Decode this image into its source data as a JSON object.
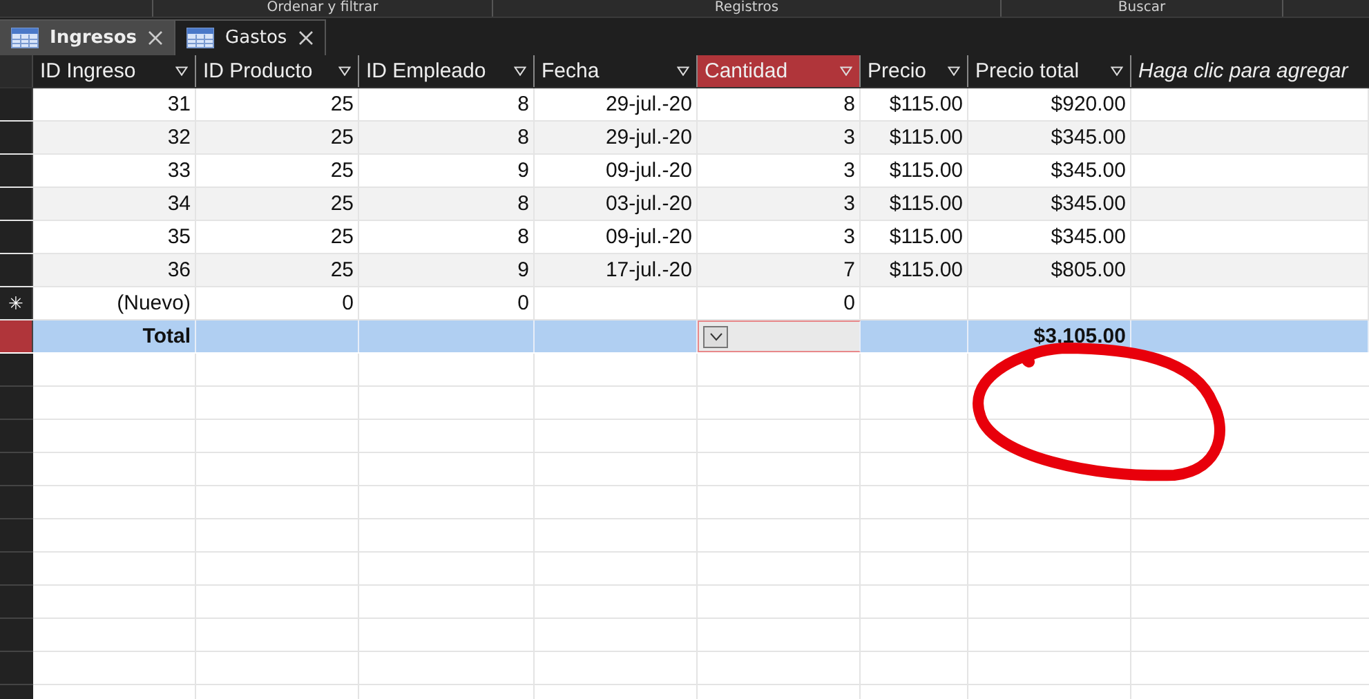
{
  "ribbon_groups": [
    "Ordenar y filtrar",
    "Registros",
    "Buscar"
  ],
  "tabs": [
    {
      "label": "Ingresos",
      "selected": true
    },
    {
      "label": "Gastos",
      "selected": false
    }
  ],
  "table": {
    "columns": [
      {
        "label": "ID Ingreso",
        "kind": "field",
        "selected": false
      },
      {
        "label": "ID Producto",
        "kind": "field",
        "selected": false
      },
      {
        "label": "ID Empleado",
        "kind": "field",
        "selected": false
      },
      {
        "label": "Fecha",
        "kind": "field",
        "selected": false
      },
      {
        "label": "Cantidad",
        "kind": "field",
        "selected": true
      },
      {
        "label": "Precio",
        "kind": "field",
        "selected": false
      },
      {
        "label": "Precio total",
        "kind": "field",
        "selected": false
      },
      {
        "label": "Haga clic para agregar",
        "kind": "add",
        "selected": false
      }
    ],
    "rows": [
      {
        "kind": "data",
        "selected": false,
        "cells": [
          "31",
          "25",
          "8",
          "29-jul.-20",
          "8",
          "$115.00",
          "$920.00"
        ]
      },
      {
        "kind": "data",
        "selected": false,
        "cells": [
          "32",
          "25",
          "8",
          "29-jul.-20",
          "3",
          "$115.00",
          "$345.00"
        ]
      },
      {
        "kind": "data",
        "selected": false,
        "cells": [
          "33",
          "25",
          "9",
          "09-jul.-20",
          "3",
          "$115.00",
          "$345.00"
        ]
      },
      {
        "kind": "data",
        "selected": false,
        "cells": [
          "34",
          "25",
          "8",
          "03-jul.-20",
          "3",
          "$115.00",
          "$345.00"
        ]
      },
      {
        "kind": "data",
        "selected": false,
        "cells": [
          "35",
          "25",
          "8",
          "09-jul.-20",
          "3",
          "$115.00",
          "$345.00"
        ]
      },
      {
        "kind": "data",
        "selected": false,
        "cells": [
          "36",
          "25",
          "9",
          "17-jul.-20",
          "7",
          "$115.00",
          "$805.00"
        ]
      },
      {
        "kind": "new",
        "selected": false,
        "marker": "✳",
        "cells": [
          "(Nuevo)",
          "0",
          "0",
          null,
          "0",
          null,
          null
        ]
      },
      {
        "kind": "total",
        "selected": true,
        "cells": [
          "Total",
          null,
          null,
          null,
          {
            "dropdown": true
          },
          null,
          "$3,105.00"
        ]
      }
    ]
  }
}
